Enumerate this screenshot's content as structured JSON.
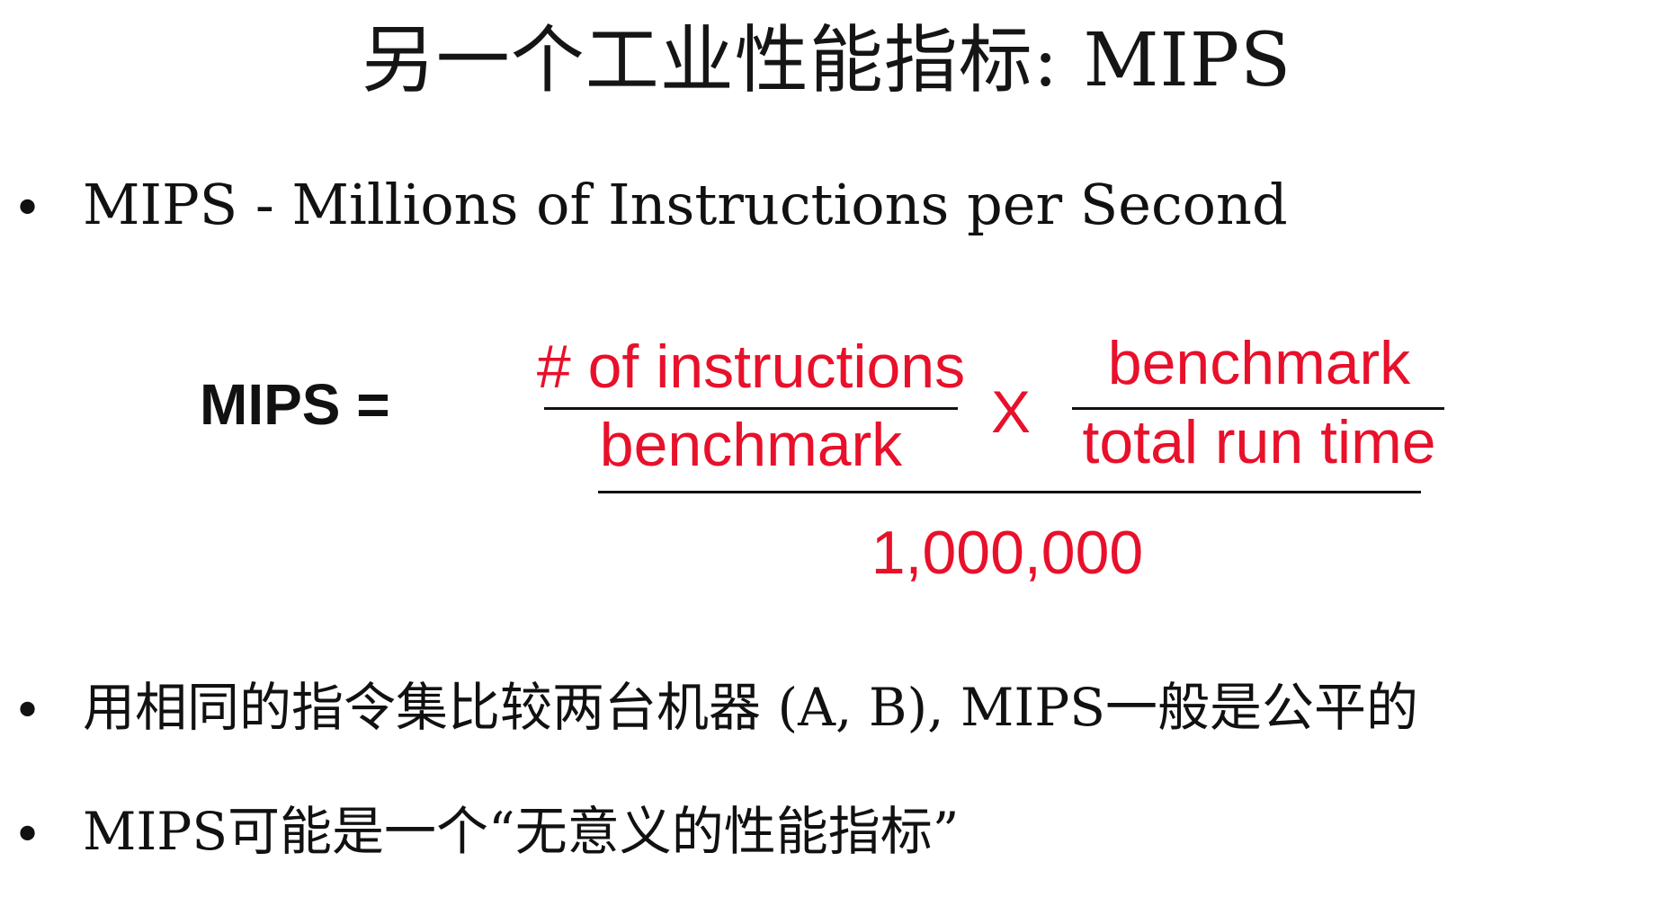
{
  "slide": {
    "title": "另一个工业性能指标: MIPS",
    "bullets": [
      "MIPS - Millions of Instructions per Second",
      "用相同的指令集比较两台机器 (A, B), MIPS一般是公平的",
      "MIPS可能是一个“无意义的性能指标”"
    ],
    "bullet_symbol": "•"
  },
  "formula": {
    "lhs": "MIPS =",
    "frac1_numerator": "# of instructions",
    "frac1_denominator": "benchmark",
    "operator": "X",
    "frac2_numerator": "benchmark",
    "frac2_denominator": "total run time",
    "outer_denominator": "1,000,000"
  },
  "colors": {
    "formula_red": "#e8102a",
    "text_dark": "#111111"
  }
}
